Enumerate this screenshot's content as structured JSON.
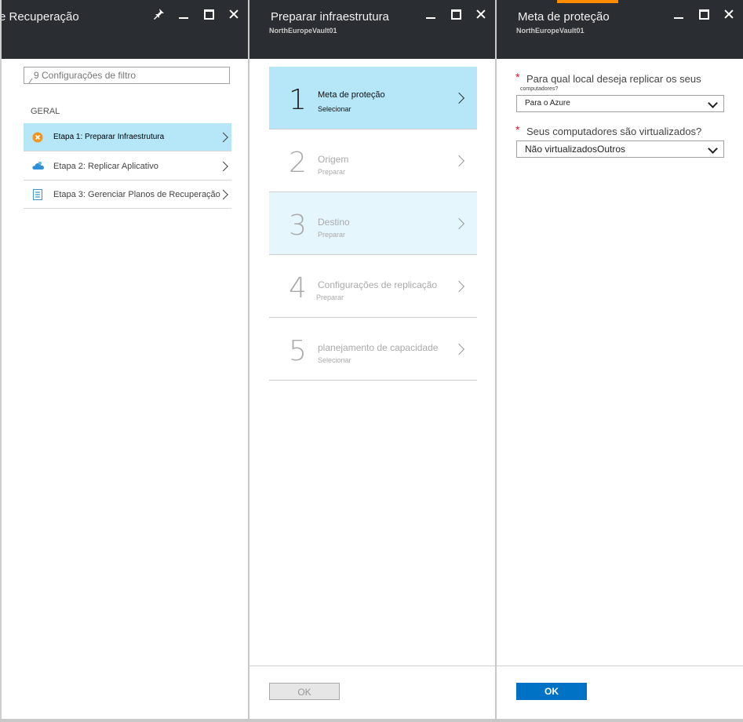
{
  "blade1": {
    "title": "e Recuperação",
    "filter_placeholder": "9 Configurações de filtro",
    "section": "GERAL",
    "items": [
      {
        "label": "Etapa 1: Preparar Infraestrutura",
        "icon": "warning-icon"
      },
      {
        "label": "Etapa 2: Replicar Aplicativo",
        "icon": "cloud-icon"
      },
      {
        "label": "Etapa 3: Gerenciar Planos de Recuperação",
        "icon": "document-list-icon"
      }
    ]
  },
  "blade2": {
    "title": "Preparar infraestrutura",
    "subtitle": "NorthEuropeVault01",
    "steps": [
      {
        "num": "1",
        "title": "Meta de proteção",
        "sub": "Selecionar"
      },
      {
        "num": "2",
        "title": "Origem",
        "sub": "Preparar"
      },
      {
        "num": "3",
        "title": "Destino",
        "sub": "Preparar"
      },
      {
        "num": "4",
        "title": "Configurações de replicação",
        "sub": "Preparar"
      },
      {
        "num": "5",
        "title": "planejamento de capacidade",
        "sub": "Selecionar"
      }
    ],
    "ok_label": "OK"
  },
  "blade3": {
    "title": "Meta de proteção",
    "subtitle": "NorthEuropeVault01",
    "q1_label": "Para qual local deseja replicar os seus",
    "q1_small": "computadores?",
    "q1_value": "Para o Azure",
    "q2_label": "Seus computadores são virtualizados?",
    "q2_value": "Não virtualizadosOutros",
    "ok_label": "OK"
  },
  "required_mark": "*",
  "colors": {
    "header": "#2a2d31",
    "selected": "#b5e7f8",
    "accent": "#ff8c00",
    "primary": "#0072c6"
  }
}
